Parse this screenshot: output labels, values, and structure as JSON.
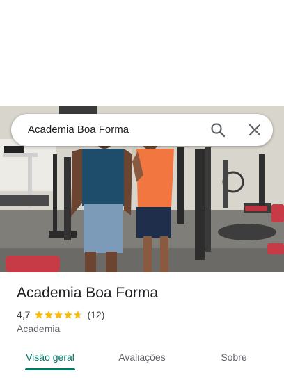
{
  "search": {
    "query": "Academia Boa Forma"
  },
  "place": {
    "name": "Academia Boa Forma",
    "rating": "4,7",
    "rating_stars": 4.7,
    "review_count": "(12)",
    "category": "Academia"
  },
  "tabs": [
    {
      "label": "Visão geral",
      "active": true
    },
    {
      "label": "Avaliações",
      "active": false
    },
    {
      "label": "Sobre",
      "active": false
    }
  ],
  "colors": {
    "accent": "#00796b",
    "star": "#fbbc04",
    "title": "#202124",
    "secondary": "#5f6368"
  },
  "icons": {
    "search": "search-icon",
    "close": "close-icon"
  }
}
